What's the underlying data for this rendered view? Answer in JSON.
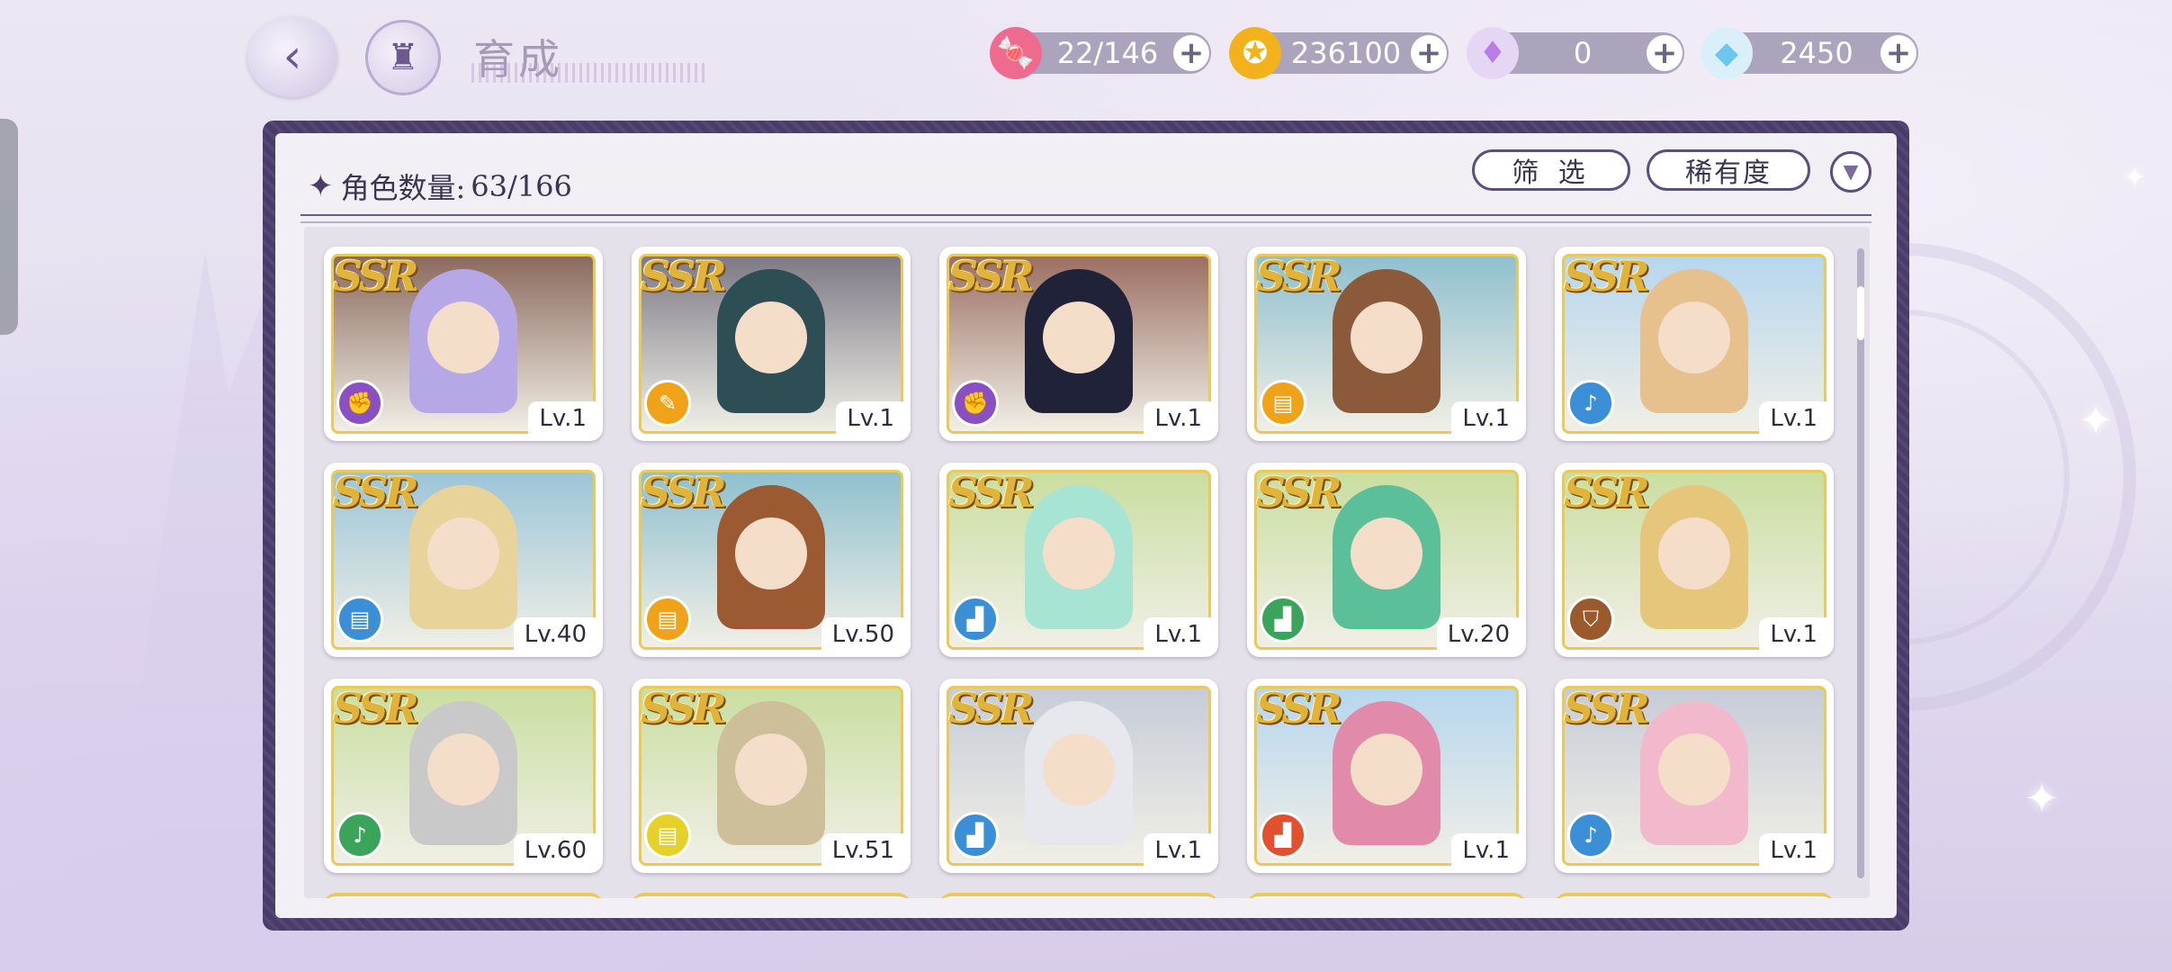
{
  "header": {
    "title": "育成",
    "resources": [
      {
        "name": "stamina",
        "icon": "candy-icon",
        "value": "22/146",
        "color": "#ee6b8f"
      },
      {
        "name": "gold",
        "icon": "coin-icon",
        "value": "236100",
        "color": "#f3b21c"
      },
      {
        "name": "rainbow-gem",
        "icon": "rainbow-gem-icon",
        "value": "0",
        "color": "#b97de8"
      },
      {
        "name": "diamond",
        "icon": "diamond-icon",
        "value": "2450",
        "color": "#6cc6ef"
      }
    ]
  },
  "roster": {
    "count_label": "角色数量:",
    "count_value": "63/166",
    "filter_label": "筛 选",
    "sort_label": "稀有度"
  },
  "cards": [
    {
      "rarity": "SSR",
      "level": "Lv.1",
      "type_icon": "fist-icon",
      "type_color": "#8a4fc3",
      "hair": "#b6a8e6",
      "bg": "#8c6a5e"
    },
    {
      "rarity": "SSR",
      "level": "Lv.1",
      "type_icon": "pen-icon",
      "type_color": "#f0a318",
      "hair": "#2d4e55",
      "bg": "#7d7a86"
    },
    {
      "rarity": "SSR",
      "level": "Lv.1",
      "type_icon": "fist-icon",
      "type_color": "#8a4fc3",
      "hair": "#1f2238",
      "bg": "#9c6f63"
    },
    {
      "rarity": "SSR",
      "level": "Lv.1",
      "type_icon": "book-icon",
      "type_color": "#f0a318",
      "hair": "#8a5a3a",
      "bg": "#8fc0cf"
    },
    {
      "rarity": "SSR",
      "level": "Lv.1",
      "type_icon": "microphone-icon",
      "type_color": "#3a8fd6",
      "hair": "#e6c08d",
      "bg": "#b6d6ee"
    },
    {
      "rarity": "SSR",
      "level": "Lv.40",
      "type_icon": "book-icon",
      "type_color": "#3a8fd6",
      "hair": "#e8d49a",
      "bg": "#9bc5d8"
    },
    {
      "rarity": "SSR",
      "level": "Lv.50",
      "type_icon": "book-icon",
      "type_color": "#f0a318",
      "hair": "#9c5a33",
      "bg": "#8fc0cf"
    },
    {
      "rarity": "SSR",
      "level": "Lv.1",
      "type_icon": "boot-icon",
      "type_color": "#3a8fd6",
      "hair": "#a8e4d3",
      "bg": "#c9dea0"
    },
    {
      "rarity": "SSR",
      "level": "Lv.20",
      "type_icon": "boot-icon",
      "type_color": "#3aa55a",
      "hair": "#5bbf9a",
      "bg": "#c9dea0"
    },
    {
      "rarity": "SSR",
      "level": "Lv.1",
      "type_icon": "shield-icon",
      "type_color": "#9a5a2c",
      "hair": "#e6c67a",
      "bg": "#c9dea0"
    },
    {
      "rarity": "SSR",
      "level": "Lv.60",
      "type_icon": "microphone-icon",
      "type_color": "#3aa55a",
      "hair": "#c9c9c9",
      "bg": "#c9dea0"
    },
    {
      "rarity": "SSR",
      "level": "Lv.51",
      "type_icon": "book-icon",
      "type_color": "#e6d12a",
      "hair": "#cdbf9a",
      "bg": "#c9dea0"
    },
    {
      "rarity": "SSR",
      "level": "Lv.1",
      "type_icon": "boot-icon",
      "type_color": "#3a8fd6",
      "hair": "#e7e7ee",
      "bg": "#c6ccd8"
    },
    {
      "rarity": "SSR",
      "level": "Lv.1",
      "type_icon": "boot-icon",
      "type_color": "#e2502e",
      "hair": "#e28aa9",
      "bg": "#b6d6ee"
    },
    {
      "rarity": "SSR",
      "level": "Lv.1",
      "type_icon": "microphone-icon",
      "type_color": "#3a8fd6",
      "hair": "#f2b9cc",
      "bg": "#c6ccd8"
    }
  ]
}
